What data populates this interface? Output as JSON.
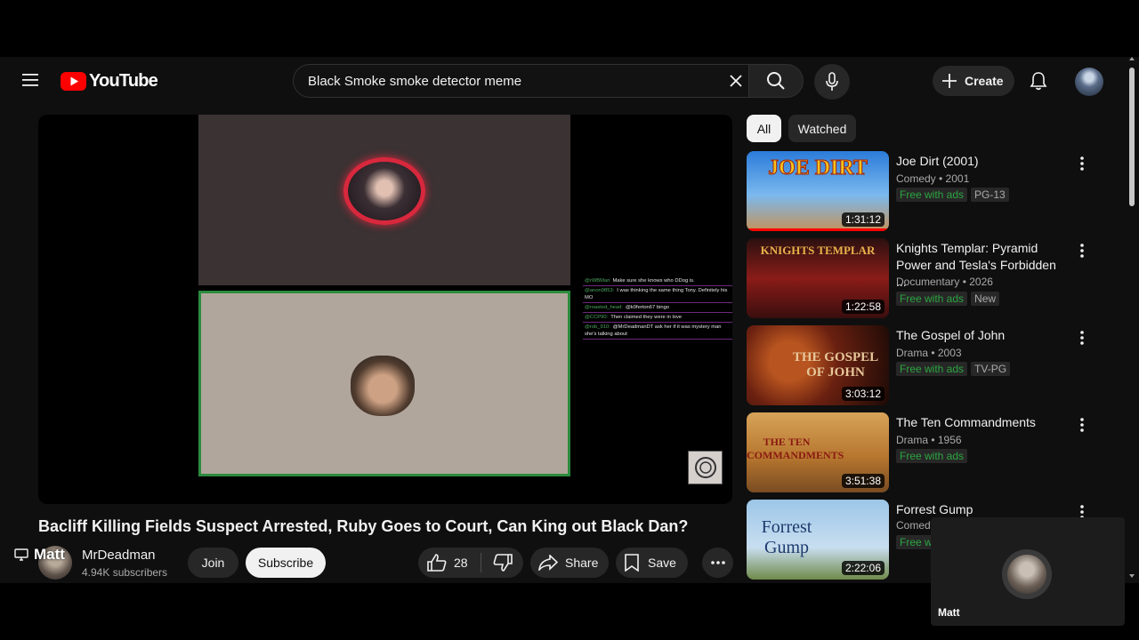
{
  "header": {
    "logo_text": "YouTube",
    "search_value": "Black Smoke smoke detector meme",
    "create_label": "Create",
    "icons": [
      "menu-icon",
      "youtube-logo-icon",
      "close-icon",
      "search-icon",
      "mic-icon",
      "plus-icon",
      "bell-icon"
    ]
  },
  "player": {
    "chat": [
      {
        "user": "@rWBMan",
        "text": "Make sure she knows who DDog is."
      },
      {
        "user": "@anon9853:",
        "text": "I was thinking the same thing Tony. Definitely his MO"
      },
      {
        "user": "@roasted_head:",
        "text": "@k0ferton67 bingo"
      },
      {
        "user": "@CCP90:",
        "text": "Then claimed they were in love"
      },
      {
        "user": "@rob_910:",
        "text": "@MrDeadmanDT ask her if it was mystery man she's talking about"
      }
    ]
  },
  "video": {
    "title": "Bacliff Killing Fields Suspect Arrested, Ruby Goes to Court, Can King out Black Dan?",
    "cast_label": "Matt",
    "channel_name": "MrDeadman",
    "subscribers": "4.94K subscribers",
    "join_label": "Join",
    "subscribe_label": "Subscribe",
    "like_count": "28",
    "share_label": "Share",
    "save_label": "Save"
  },
  "chips": {
    "all": "All",
    "watched": "Watched"
  },
  "recommendations": [
    {
      "title": "Joe Dirt (2001)",
      "meta": "Comedy • 2001",
      "badges": [
        "Free with ads",
        "PG-13"
      ],
      "duration": "1:31:12",
      "thumb_text": "JOE DIRT",
      "watched_progress": 1.0
    },
    {
      "title": "Knights Templar: Pyramid Power and Tesla's Forbidden ...",
      "meta": "Documentary • 2026",
      "badges": [
        "Free with ads",
        "New"
      ],
      "duration": "1:22:58",
      "thumb_text": "KNIGHTS TEMPLAR"
    },
    {
      "title": "The Gospel of John",
      "meta": "Drama • 2003",
      "badges": [
        "Free with ads",
        "TV-PG"
      ],
      "duration": "3:03:12",
      "thumb_text": "THE GOSPEL OF JOHN"
    },
    {
      "title": "The Ten Commandments",
      "meta": "Drama • 1956",
      "badges": [
        "Free with ads"
      ],
      "duration": "3:51:38",
      "thumb_text": "THE TEN COMMANDMENTS"
    },
    {
      "title": "Forrest Gump",
      "meta": "Comedy",
      "badges": [
        "Free w"
      ],
      "duration": "2:22:06",
      "thumb_text": "Forrest Gump"
    }
  ],
  "floating_tile": {
    "name": "Matt"
  },
  "colors": {
    "brand_red": "#ff0000",
    "free_green": "#2ba640",
    "background": "#0f0f0f"
  }
}
